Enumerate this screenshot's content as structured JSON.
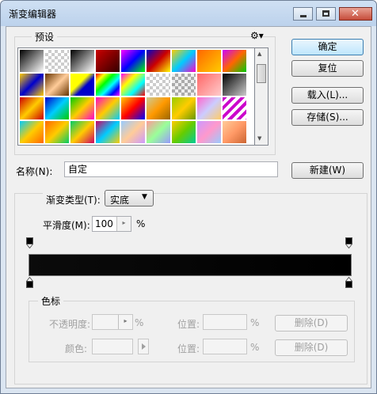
{
  "window": {
    "title": "渐变编辑器"
  },
  "presets": {
    "title": "预设"
  },
  "buttons": {
    "ok": "确定",
    "reset": "复位",
    "load": "载入(L)...",
    "save": "存储(S)...",
    "new": "新建(W)"
  },
  "name": {
    "label": "名称(N):",
    "value": "自定"
  },
  "gradient_type": {
    "label": "渐变类型(T):",
    "value": "实底"
  },
  "smoothness": {
    "label": "平滑度(M):",
    "value": "100",
    "unit": "%"
  },
  "color_stops": {
    "title": "色标",
    "opacity_label": "不透明度:",
    "opacity_unit": "%",
    "location_label": "位置:",
    "location_unit": "%",
    "delete_label": "删除(D)",
    "color_label": "颜色:",
    "location2_label": "位置:",
    "location2_unit": "%",
    "delete2_label": "删除(D)"
  },
  "gradient": {
    "start_color": "#000000",
    "end_color": "#000000"
  }
}
